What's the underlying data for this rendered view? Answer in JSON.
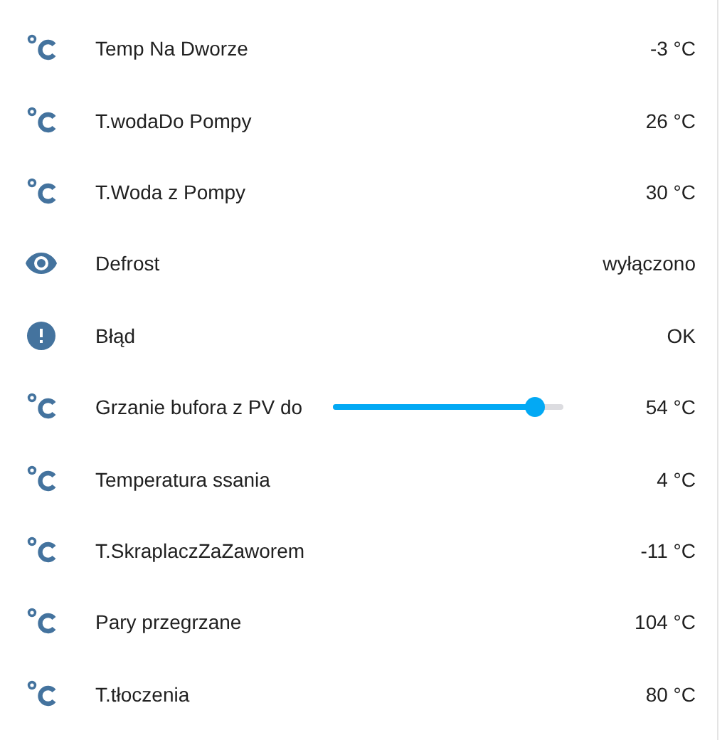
{
  "entities": [
    {
      "kind": "temperature",
      "name": "Temp Na Dworze",
      "value": "-3 °C"
    },
    {
      "kind": "temperature",
      "name": "T.wodaDo Pompy",
      "value": "26 °C"
    },
    {
      "kind": "temperature",
      "name": "T.Woda z Pompy",
      "value": "30 °C"
    },
    {
      "kind": "binary",
      "name": "Defrost",
      "value": "wyłączono"
    },
    {
      "kind": "problem",
      "name": "Błąd",
      "value": "OK"
    },
    {
      "kind": "slider",
      "name": "Grzanie bufora z PV do",
      "value": "54 °C",
      "level": 0.88
    },
    {
      "kind": "temperature",
      "name": "Temperatura ssania",
      "value": "4 °C"
    },
    {
      "kind": "temperature",
      "name": "T.SkraplaczZaZaworem",
      "value": "-11 °C"
    },
    {
      "kind": "temperature",
      "name": "Pary przegrzane",
      "value": "104 °C"
    },
    {
      "kind": "temperature",
      "name": "T.tłoczenia",
      "value": "80 °C"
    }
  ]
}
